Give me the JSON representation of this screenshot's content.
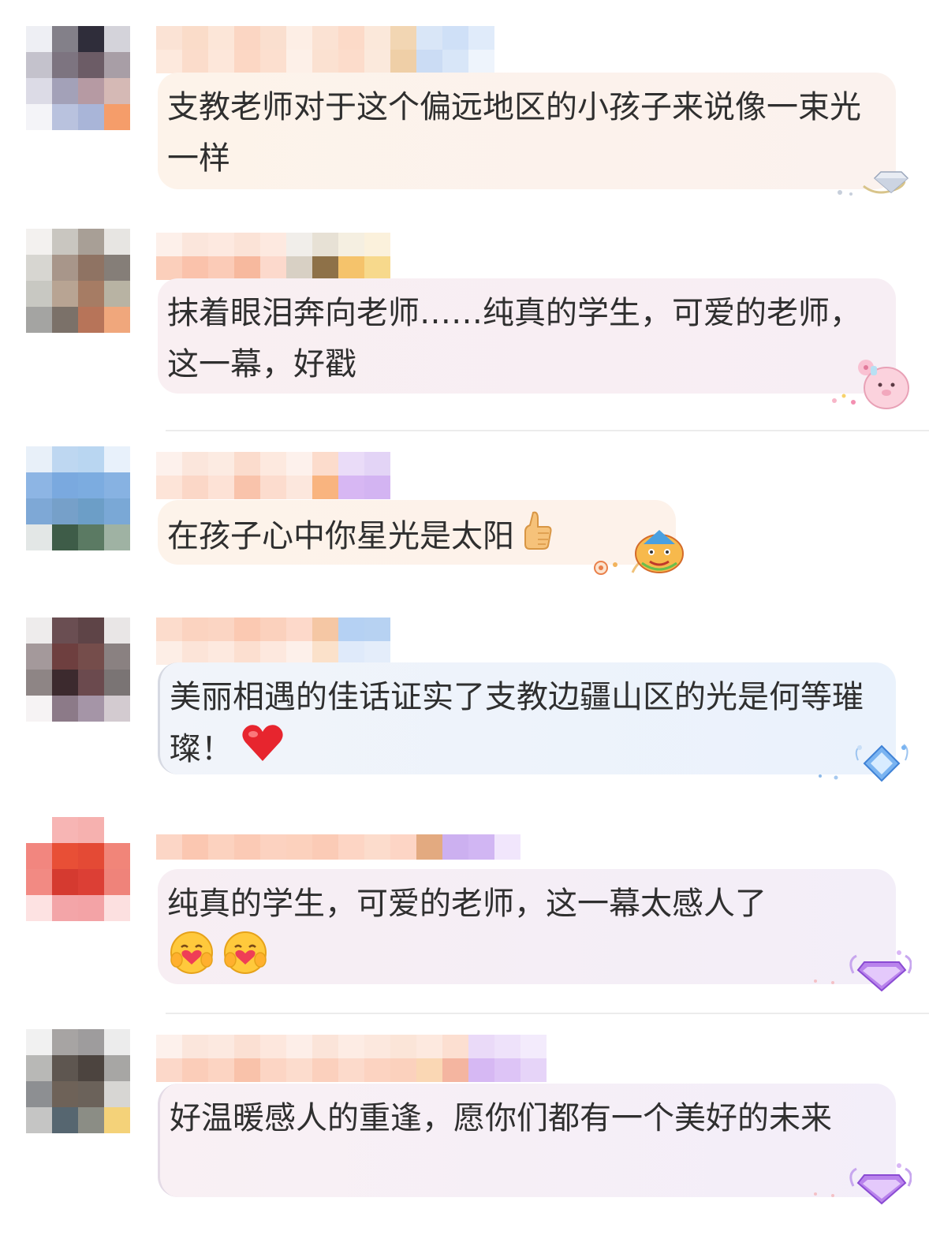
{
  "comments": [
    {
      "text": "支教老师对于这个偏远地区的小孩子来说像一束光一样"
    },
    {
      "text": "抹着眼泪奔向老师……纯真的学生，可爱的老师，这一幕，好戳"
    },
    {
      "text": "在孩子心中你星光是太阳",
      "emoji": "thumbs-up-icon"
    },
    {
      "text": "美丽相遇的佳话证实了支教边疆山区的光是何等璀璨！",
      "emoji": "red-heart-icon"
    },
    {
      "text": "纯真的学生，可爱的老师，这一幕太感人了",
      "emoji": "hugging-face-icon"
    },
    {
      "text": "好温暖感人的重逢，愿你们都有一个美好的未来"
    }
  ],
  "colors": {
    "text": "#2f2f2f",
    "divider": "#ececec",
    "bubble_peach": "#fdf1e6",
    "bubble_pink": "#f8eef3",
    "bubble_blue": "#eef3fb",
    "bubble_lilac": "#f4eef8"
  }
}
